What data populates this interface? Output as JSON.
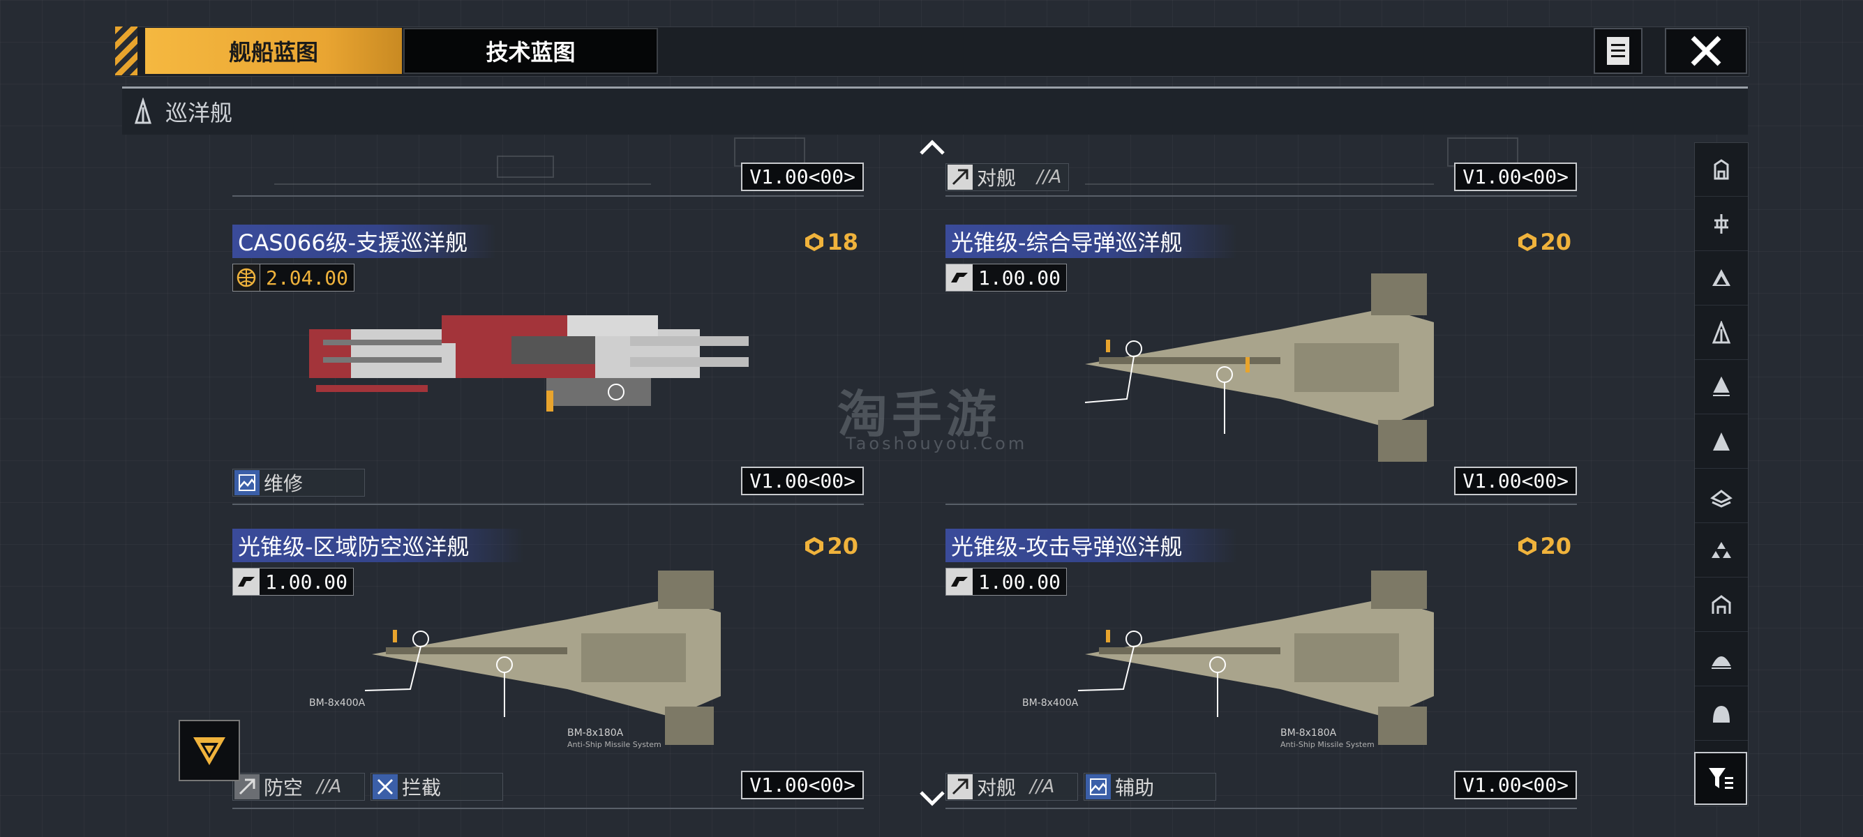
{
  "tabs": {
    "ship_blueprint": "舰船蓝图",
    "tech_blueprint": "技术蓝图"
  },
  "category": {
    "label": "巡洋舰",
    "icon": "cruiser-icon"
  },
  "top_partial": {
    "left_version": "V1.00<00>",
    "right_tag": "对舰",
    "right_tag_grade": "//A",
    "right_version": "V1.00<00>"
  },
  "cards": [
    {
      "title": "CAS066级-支援巡洋舰",
      "stat": "2.04.00",
      "stat_icon": "globe-icon",
      "cost": "18",
      "version": "V1.00<00>",
      "tags": [
        {
          "label": "维修",
          "grade": ""
        }
      ],
      "hull_color": "#c9c9c9",
      "accent_color": "#a3343a"
    },
    {
      "title": "光锥级-综合导弹巡洋舰",
      "stat": "1.00.00",
      "stat_icon": "faction-icon",
      "cost": "20",
      "version": "V1.00<00>",
      "tags": [],
      "hull_color": "#a9a48c",
      "accent_color": "#e8a42d"
    },
    {
      "title": "光锥级-区域防空巡洋舰",
      "stat": "1.00.00",
      "stat_icon": "faction-icon",
      "cost": "20",
      "version": "V1.00<00>",
      "tags": [
        {
          "label": "防空",
          "grade": "//A"
        },
        {
          "label": "拦截",
          "grade": ""
        }
      ],
      "hull_color": "#a9a48c",
      "accent_color": "#e8a42d",
      "callouts": [
        "BM-8x400A",
        "BM-8x180A",
        "Anti-Ship Missile System"
      ]
    },
    {
      "title": "光锥级-攻击导弹巡洋舰",
      "stat": "1.00.00",
      "stat_icon": "faction-icon",
      "cost": "20",
      "version": "V1.00<00>",
      "tags": [
        {
          "label": "对舰",
          "grade": "//A"
        },
        {
          "label": "辅助",
          "grade": ""
        }
      ],
      "hull_color": "#a9a48c",
      "accent_color": "#e8a42d",
      "callouts": [
        "BM-8x400A",
        "BM-8x180A",
        "Anti-Ship Missile System"
      ]
    }
  ],
  "watermark": {
    "main": "淘手游",
    "sub": "Taoshouyou.Com"
  },
  "colors": {
    "gold": "#f0b33c",
    "title_blue": "#3a4b9a",
    "bg": "#262b33"
  }
}
